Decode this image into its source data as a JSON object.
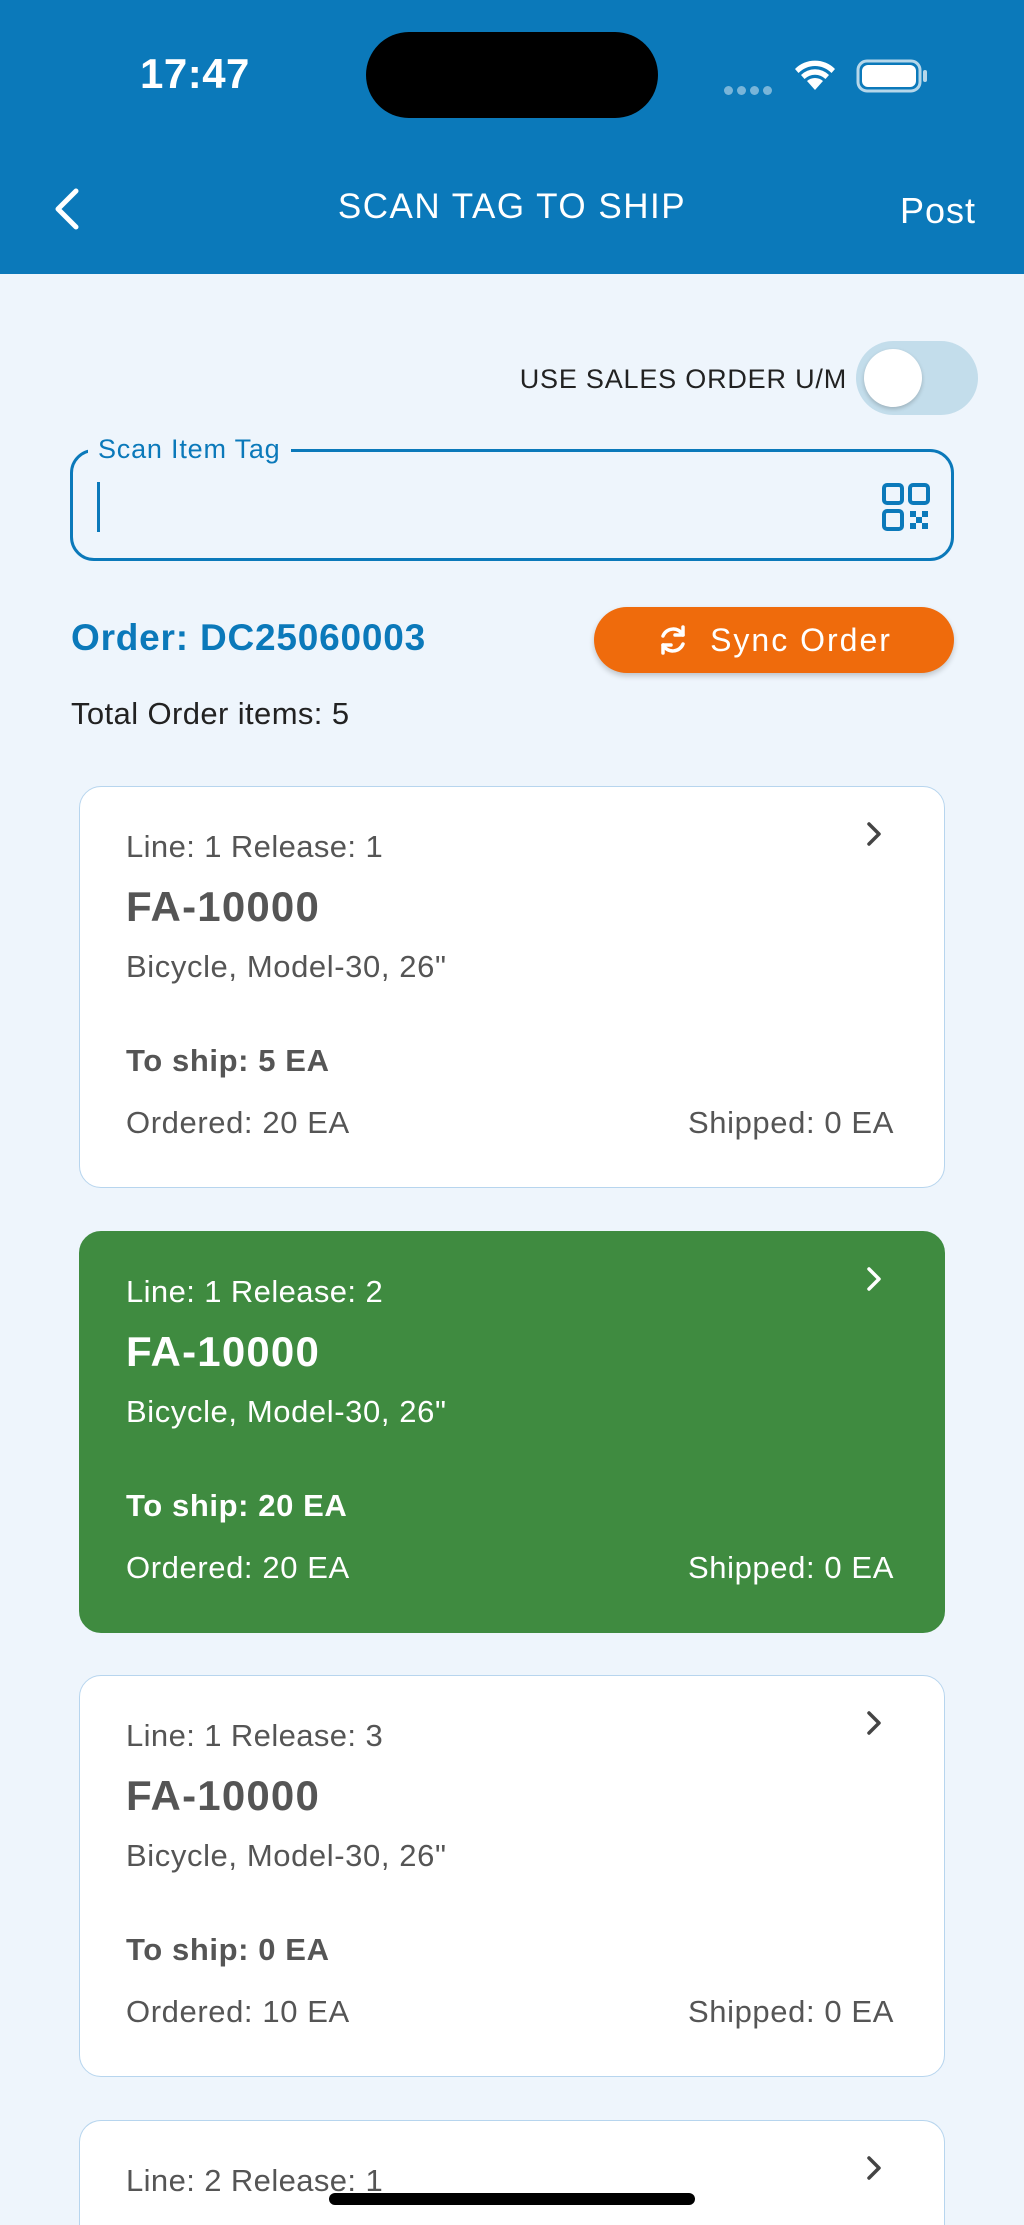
{
  "status_bar": {
    "time": "17:47"
  },
  "nav": {
    "title": "SCAN TAG TO SHIP",
    "post_label": "Post"
  },
  "toggle": {
    "label": "USE SALES ORDER U/M",
    "on": false
  },
  "scan": {
    "legend": "Scan Item Tag",
    "value": ""
  },
  "order": {
    "title": "Order: DC25060003",
    "sync_label": "Sync Order",
    "total_items": "Total Order items: 5"
  },
  "colors": {
    "header": "#0b79ba",
    "accent": "#0b79ba",
    "sync": "#ef6b0c",
    "selected_card": "#3f8b40",
    "background": "#eef5fc"
  },
  "items": [
    {
      "line_release": "Line: 1 Release: 1",
      "code": "FA-10000",
      "description": "Bicycle, Model-30, 26\"",
      "to_ship": "To ship: 5 EA",
      "ordered": "Ordered: 20 EA",
      "shipped": "Shipped: 0 EA",
      "selected": false
    },
    {
      "line_release": "Line: 1 Release: 2",
      "code": "FA-10000",
      "description": "Bicycle, Model-30, 26\"",
      "to_ship": "To ship: 20 EA",
      "ordered": "Ordered: 20 EA",
      "shipped": "Shipped: 0 EA",
      "selected": true
    },
    {
      "line_release": "Line: 1 Release: 3",
      "code": "FA-10000",
      "description": "Bicycle, Model-30, 26\"",
      "to_ship": "To ship: 0 EA",
      "ordered": "Ordered: 10 EA",
      "shipped": "Shipped: 0 EA",
      "selected": false
    },
    {
      "line_release": "Line: 2 Release: 1"
    }
  ]
}
